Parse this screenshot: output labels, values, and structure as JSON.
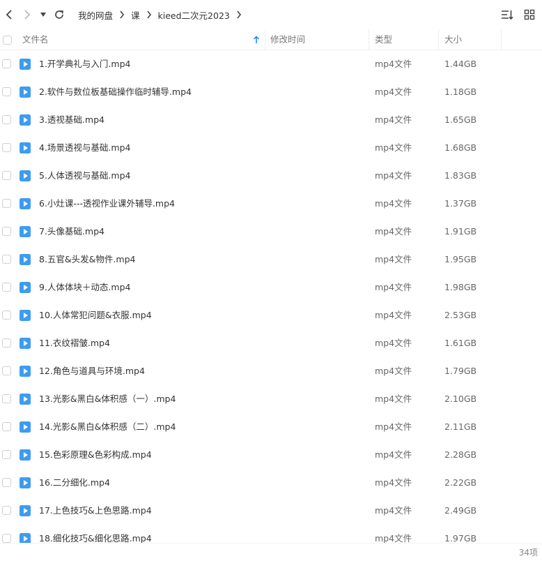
{
  "colors": {
    "accent": "#2b8ef0",
    "file_icon": "#3d9cf0",
    "text": "#333333",
    "muted": "#777777"
  },
  "toolbar": {
    "back_icon": "chevron-left-icon",
    "forward_icon": "chevron-right-icon",
    "history_icon": "caret-down-icon",
    "refresh_icon": "refresh-icon",
    "sort_icon": "sort-list-icon",
    "grid_icon": "grid-view-icon"
  },
  "breadcrumb": [
    "我的网盘",
    "课",
    "kieed二次元2023"
  ],
  "columns": {
    "name": "文件名",
    "modified": "修改时间",
    "type": "类型",
    "size": "大小"
  },
  "files": [
    {
      "name": "1.开学典礼与入门.mp4",
      "type": "mp4文件",
      "size": "1.44GB"
    },
    {
      "name": "2.软件与数位板基础操作临时辅导.mp4",
      "type": "mp4文件",
      "size": "1.18GB"
    },
    {
      "name": "3.透视基础.mp4",
      "type": "mp4文件",
      "size": "1.65GB"
    },
    {
      "name": "4.场景透视与基础.mp4",
      "type": "mp4文件",
      "size": "1.68GB"
    },
    {
      "name": "5.人体透视与基础.mp4",
      "type": "mp4文件",
      "size": "1.83GB"
    },
    {
      "name": "6.小灶课---透视作业课外辅导.mp4",
      "type": "mp4文件",
      "size": "1.37GB"
    },
    {
      "name": "7.头像基础.mp4",
      "type": "mp4文件",
      "size": "1.91GB"
    },
    {
      "name": "8.五官&头发&物件.mp4",
      "type": "mp4文件",
      "size": "1.95GB"
    },
    {
      "name": "9.人体体块＋动态.mp4",
      "type": "mp4文件",
      "size": "1.98GB"
    },
    {
      "name": "10.人体常犯问题&衣服.mp4",
      "type": "mp4文件",
      "size": "2.53GB"
    },
    {
      "name": "11.衣纹褶皱.mp4",
      "type": "mp4文件",
      "size": "1.61GB"
    },
    {
      "name": "12.角色与道具与环境.mp4",
      "type": "mp4文件",
      "size": "1.79GB"
    },
    {
      "name": "13.光影&黑白&体积感（一）.mp4",
      "type": "mp4文件",
      "size": "2.10GB"
    },
    {
      "name": "14.光影&黑白&体积感（二）.mp4",
      "type": "mp4文件",
      "size": "2.11GB"
    },
    {
      "name": "15.色彩原理&色彩构成.mp4",
      "type": "mp4文件",
      "size": "2.28GB"
    },
    {
      "name": "16.二分细化.mp4",
      "type": "mp4文件",
      "size": "2.22GB"
    },
    {
      "name": "17.上色技巧&上色思路.mp4",
      "type": "mp4文件",
      "size": "2.49GB"
    },
    {
      "name": "18.细化技巧&细化思路.mp4",
      "type": "mp4文件",
      "size": "1.97GB"
    }
  ],
  "footer": {
    "count": "34项"
  }
}
